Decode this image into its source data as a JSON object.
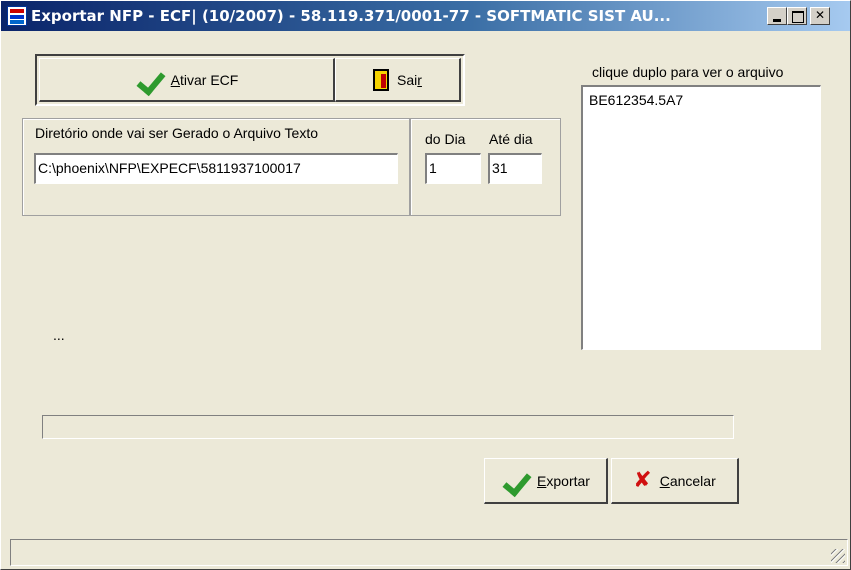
{
  "window": {
    "title": "Exportar NFP - ECF| (10/2007) - 58.119.371/0001-77 - SOFTMATIC SIST AU...",
    "close_glyph": "✕"
  },
  "toolbar": {
    "ativar_label_accel": "A",
    "ativar_label_rest": "tivar ECF",
    "sair_label_start": "Sai",
    "sair_label_accel": "r"
  },
  "form": {
    "diretorio_label": "Diretório onde vai ser Gerado o Arquivo Texto",
    "diretorio_value": "C:\\phoenix\\NFP\\EXPECF\\5811937100017",
    "do_dia_label": "do Dia",
    "ate_dia_label": "Até dia",
    "do_dia_value": "1",
    "ate_dia_value": "31"
  },
  "file_list": {
    "hint": "clique duplo para ver o arquivo",
    "items": [
      "BE612354.5A7"
    ]
  },
  "status_text": "...",
  "progress": {
    "value": 0
  },
  "actions": {
    "exportar_accel": "E",
    "exportar_rest": "xportar",
    "cancelar_accel": "C",
    "cancelar_rest": "ancelar"
  },
  "icons": {
    "ativar": "check-icon",
    "sair": "door-exit-icon",
    "exportar": "check-icon",
    "cancelar": "red-x-icon"
  }
}
